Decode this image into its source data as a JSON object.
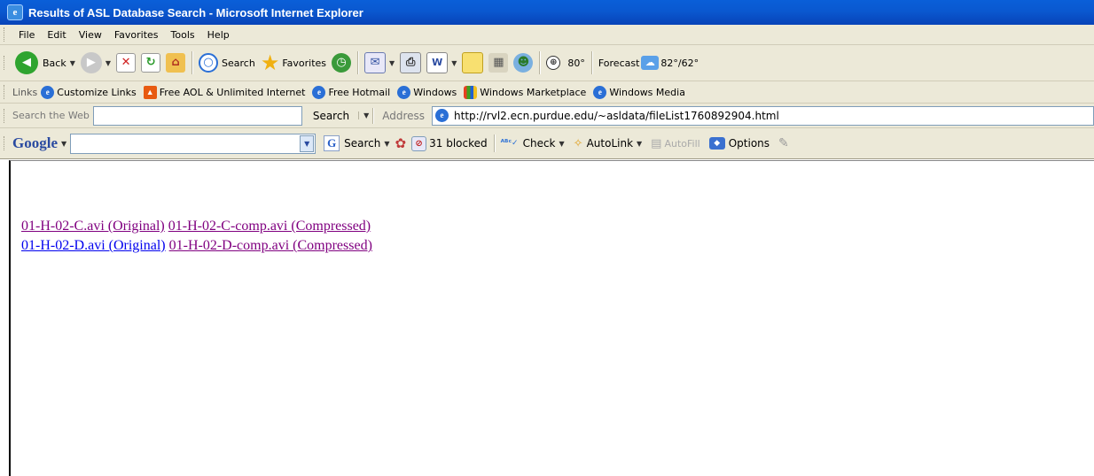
{
  "window": {
    "title": "Results of ASL Database Search - Microsoft Internet Explorer"
  },
  "menubar": {
    "items": [
      "File",
      "Edit",
      "View",
      "Favorites",
      "Tools",
      "Help"
    ]
  },
  "toolbar": {
    "back_label": "Back",
    "search_label": "Search",
    "favorites_label": "Favorites",
    "weather_temp": "80°",
    "forecast_label": "Forecast",
    "forecast_temps": "82°/62°"
  },
  "links": {
    "label": "Links",
    "items": [
      "Customize Links",
      "Free AOL & Unlimited Internet",
      "Free Hotmail",
      "Windows",
      "Windows Marketplace",
      "Windows Media"
    ]
  },
  "address": {
    "search_web_label": "Search the Web",
    "search_button": "Search",
    "address_label": "Address",
    "url": "http://rvl2.ecn.purdue.edu/~asldata/fileList1760892904.html"
  },
  "google": {
    "logo": "Google",
    "search_label": "Search",
    "blocked_label": "31 blocked",
    "check_label": "Check",
    "autolink_label": "AutoLink",
    "autofill_label": "AutoFill",
    "options_label": "Options"
  },
  "results": [
    {
      "original": "01-H-02-C.avi (Original)",
      "compressed": "01-H-02-C-comp.avi (Compressed)"
    },
    {
      "original": "01-H-02-D.avi (Original)",
      "compressed": "01-H-02-D-comp.avi (Compressed)"
    }
  ]
}
